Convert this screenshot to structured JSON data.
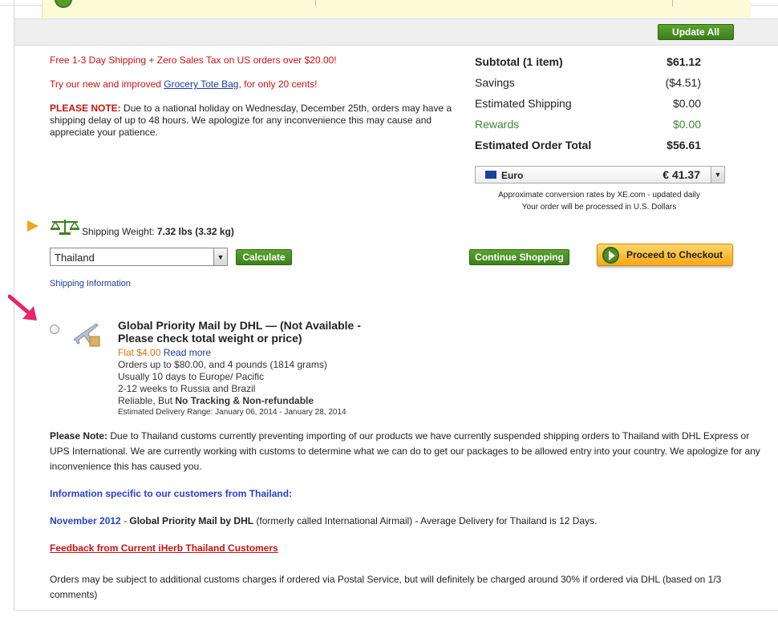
{
  "cart": {
    "update_all_label": "Update All"
  },
  "messages": {
    "free_shipping": "Free 1-3 Day Shipping + Zero Sales Tax on US orders over $20.00!",
    "try_prefix": "Try our new and improved ",
    "try_link": "Grocery Tote Bag",
    "try_suffix": ", for only 20 cents!",
    "note_label": "PLEASE NOTE:",
    "note_text": " Due to a national holiday on Wednesday, December 25th, orders may have a shipping delay of up to 48 hours. We apologize for any inconvenience this may cause and appreciate your patience."
  },
  "summary": {
    "subtotal_label": "Subtotal (1 item)",
    "subtotal_value": "$61.12",
    "savings_label": "Savings",
    "savings_value": "($4.51)",
    "shipping_label": "Estimated Shipping",
    "shipping_value": "$0.00",
    "rewards_label": "Rewards",
    "rewards_value": "$0.00",
    "total_label": "Estimated Order Total",
    "total_value": "$56.61"
  },
  "currency": {
    "name": "Euro",
    "value": "€ 41.37",
    "note1": "Approximate conversion rates by XE.com - updated daily",
    "note2": "Your order will be processed in U.S. Dollars"
  },
  "shipping": {
    "weight_label": "Shipping Weight: ",
    "weight_value": "7.32 lbs (3.32 kg)",
    "country": "Thailand",
    "calculate_label": "Calculate",
    "continue_label": "Continue Shopping",
    "checkout_label": "Proceed to Checkout",
    "info_link": "Shipping Information"
  },
  "option": {
    "title": "Global Priority Mail by DHL — (Not Available - Please check total weight or price)",
    "flat_price": "Flat $4.00",
    "read_more": "Read more",
    "line1": "Orders up to $80.00, and 4 pounds (1814 grams)",
    "line2": "Usually 10 days to Europe/ Pacific",
    "line3": "2-12 weeks to Russia and Brazil",
    "line4_prefix": "Reliable, But ",
    "line4_bold": "No Tracking & Non-refundable",
    "delivery_range": "Estimated Delivery Range: January 06, 2014 - January 28, 2014"
  },
  "notes": {
    "please_note_label": "Please Note:",
    "please_note_text": " Due to Thailand customs currently preventing importing of our products we have currently suspended shipping orders to Thailand with DHL Express or UPS International. We are currently working with customs to determine what we can do to get our packages to be allowed entry into your country. We apologize for any inconvenience this has caused you.",
    "info_heading": "Information specific to our customers from Thailand:",
    "date_label": "November 2012",
    "date_sep": " - ",
    "service_bold": "Global Priority Mail by DHL",
    "service_text": " (formerly called International Airmail) - Average Delivery for Thailand is 12 Days.",
    "feedback_link": "Feedback from Current iHerb Thailand Customers",
    "customs_text": "Orders may be subject to additional customs charges if ordered via Postal Service, but will definitely be charged around 30% if ordered via DHL (based on 1/3 comments)"
  }
}
